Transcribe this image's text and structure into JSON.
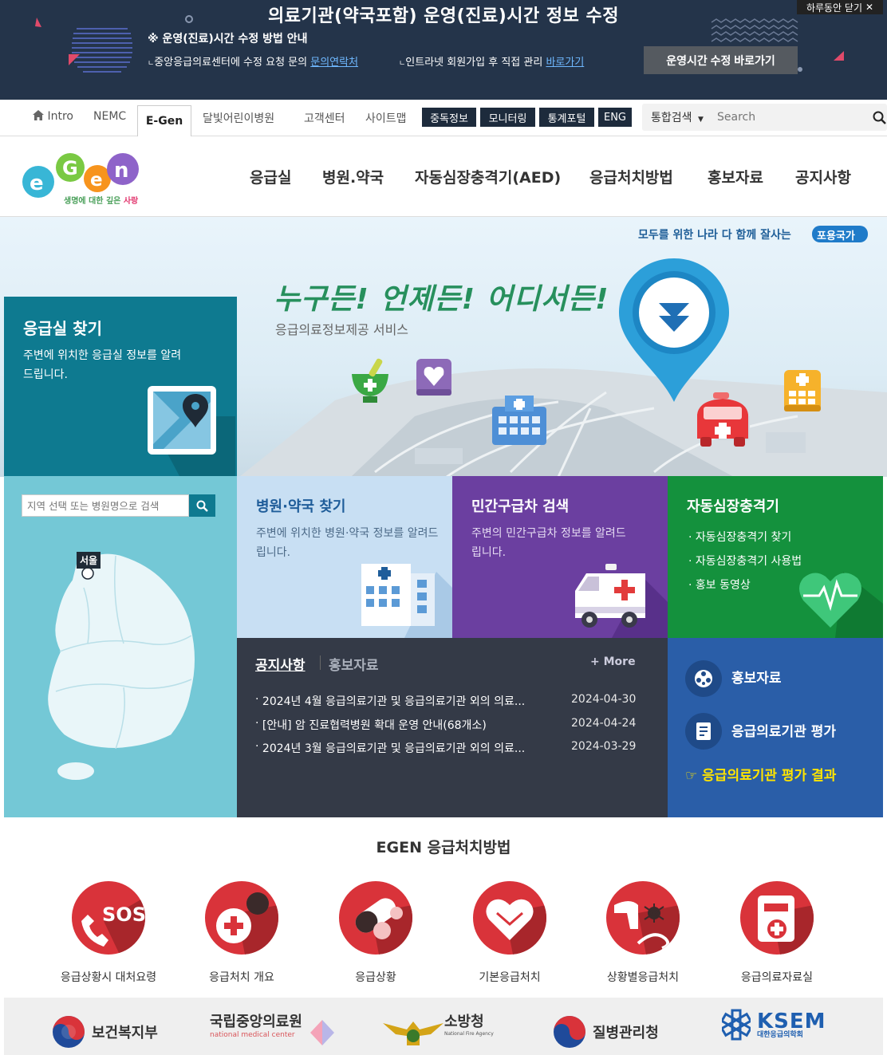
{
  "banner": {
    "title": "의료기관(약국포함) 운영(진료)시간 정보 수정",
    "guide": "※ 운영(진료)시간 수정 방법 안내",
    "line1_text": "중앙응급의료센터에 수정 요청 문의",
    "line1_link": "문의연락처",
    "line2_text": "인트라넷 회원가입 후 직접 관리",
    "line2_link": "바로가기",
    "edit_button": "운영시간 수정 바로가기",
    "close_label": "하루동안 닫기"
  },
  "util": {
    "intro": "Intro",
    "nemc": "NEMC",
    "egen": "E-Gen",
    "moon": "달빛어린이병원",
    "customer": "고객센터",
    "sitemap": "사이트맵",
    "dark_buttons": [
      "중독정보",
      "모니터링",
      "통계포털",
      "ENG"
    ],
    "search_scope": "통합검색",
    "search_placeholder": "Search"
  },
  "nav": {
    "logo_tagline_1": "생명에 대한 깊은 ",
    "logo_tagline_2": "사랑",
    "menu": [
      "응급실",
      "병원.약국",
      "자동심장충격기(AED)",
      "응급처치방법",
      "홍보자료",
      "공지사항"
    ]
  },
  "hero": {
    "slogan_prefix": "모두를 위한 나라 다 함께 잘사는",
    "slogan_badge": "포용국가",
    "headline": "누구든! 언제든! 어디서든!",
    "sub": "응급의료정보제공 서비스"
  },
  "find_er": {
    "title": "응급실 찾기",
    "desc": "주변에 위치한 응급실 정보를 알려드립니다."
  },
  "map": {
    "search_placeholder": "지역 선택 또는 병원명으로 검색",
    "selected_region": "서울"
  },
  "tiles": {
    "hospital": {
      "title": "병원·약국 찾기",
      "desc": "주변에 위치한 병원·약국 정보를 알려드립니다."
    },
    "ambulance": {
      "title": "민간구급차 검색",
      "desc": "주변의 민간구급차 정보를 알려드립니다."
    },
    "aed": {
      "title": "자동심장충격기",
      "items": [
        "자동심장충격기 찾기",
        "자동심장충격기 사용법",
        "홍보 동영상"
      ]
    }
  },
  "notice": {
    "tab_active": "공지사항",
    "tab_inactive": "홍보자료",
    "more": "More",
    "rows": [
      {
        "title": "2024년 4월 응급의료기관 및 응급의료기관 외의 의료...",
        "date": "2024-04-30"
      },
      {
        "title": "[안내] 암 진료협력병원 확대 운영 안내(68개소)",
        "date": "2024-04-24"
      },
      {
        "title": "2024년 3월 응급의료기관 및 응급의료기관 외의 의료...",
        "date": "2024-03-29"
      }
    ]
  },
  "promo": {
    "pr": "홍보자료",
    "eval": "응급의료기관 평가",
    "result": "응급의료기관 평가 결과"
  },
  "first_aid": {
    "title": "EGEN 응급처치방법",
    "items": [
      "응급상황시 대처요령",
      "응급처치 개요",
      "응급상황",
      "기본응급처치",
      "상황별응급처치",
      "응급의료자료실"
    ],
    "sos_text": "SOS"
  },
  "footer": {
    "orgs": [
      "보건복지부",
      "국립중앙의료원",
      "소방청",
      "질병관리청",
      "KSEM"
    ],
    "nmc_sub": "national medical center",
    "fire_sub": "National Fire Agency",
    "ksem_sub": "대한응급의학회"
  },
  "colors": {
    "banner_bg": "#24344a",
    "teal": "#0e7a90",
    "purple": "#6b3fa0",
    "green": "#14913d",
    "blue": "#2a5ea8",
    "dark": "#343a47",
    "red": "#d9333a"
  }
}
